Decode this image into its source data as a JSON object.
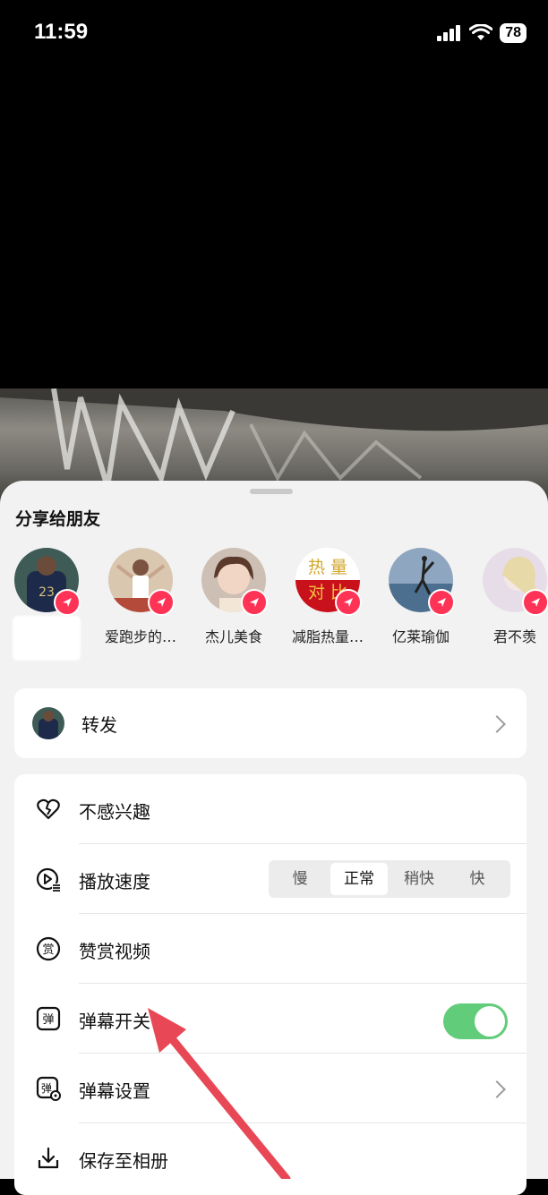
{
  "status": {
    "time": "11:59",
    "battery": "78"
  },
  "share": {
    "title": "分享给朋友",
    "friends": [
      {
        "name": ""
      },
      {
        "name": "爱跑步的…"
      },
      {
        "name": "杰儿美食"
      },
      {
        "name": "减脂热量…"
      },
      {
        "name": "亿莱瑜伽"
      },
      {
        "name": "君不羡"
      }
    ],
    "avatar_text": {
      "line1": "热 量",
      "line2": "对 比"
    }
  },
  "forward": {
    "label": "转发"
  },
  "menu": {
    "not_interested": "不感兴趣",
    "playback_speed": "播放速度",
    "speed_options": [
      "慢",
      "正常",
      "稍快",
      "快"
    ],
    "speed_selected": "正常",
    "reward_video": "赞赏视频",
    "danmaku_switch": "弹幕开关",
    "danmaku_settings": "弹幕设置",
    "save_album": "保存至相册",
    "danmaku_on": true
  },
  "colors": {
    "toggle_on": "#61cc7a",
    "badge": "#ff3355",
    "arrow": "#e84855"
  }
}
